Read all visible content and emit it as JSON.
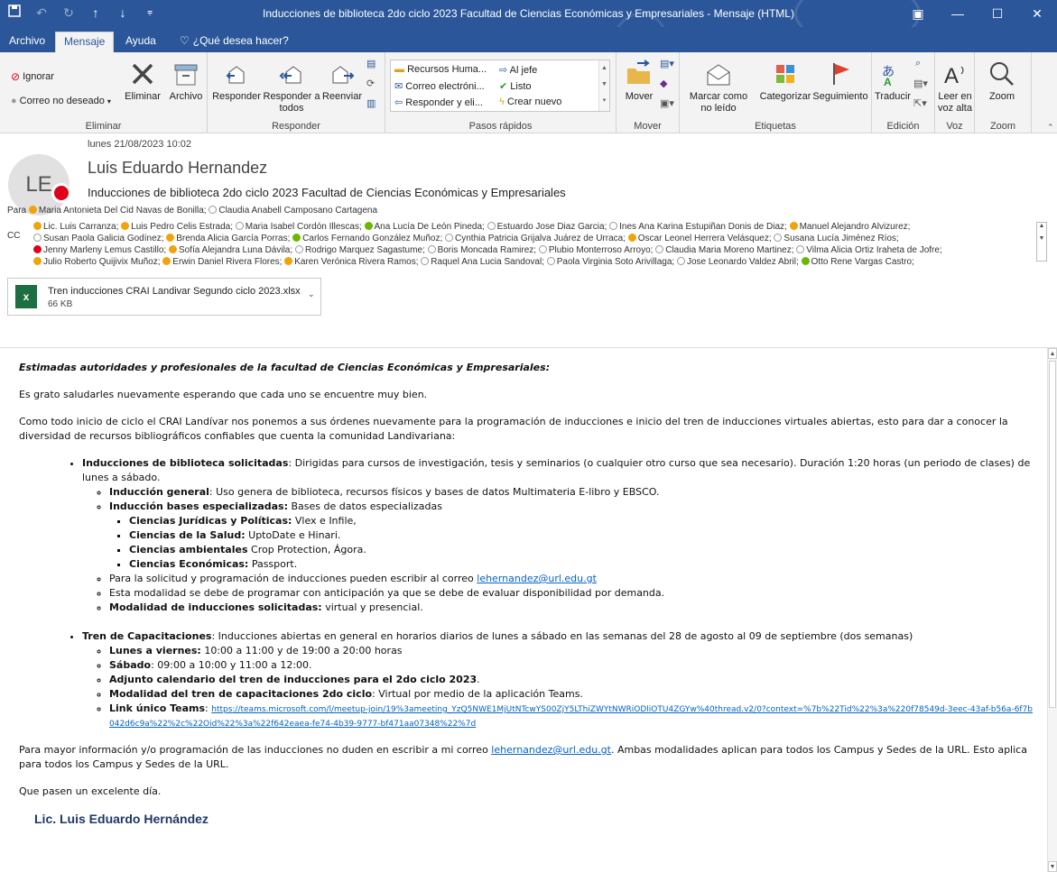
{
  "window": {
    "title": "Inducciones de biblioteca 2do ciclo 2023 Facultad de Ciencias Económicas y Empresariales - Mensaje (HTML)"
  },
  "tabs": [
    {
      "label": "Archivo"
    },
    {
      "label": "Mensaje"
    },
    {
      "label": "Ayuda"
    },
    {
      "label": "¿Qué desea hacer?"
    }
  ],
  "ribbon": {
    "eliminar": {
      "label": "Eliminar",
      "ignorar": "Ignorar",
      "junk": "Correo no deseado",
      "eliminar_btn": "Eliminar",
      "archivo": "Archivo"
    },
    "responder": {
      "label": "Responder",
      "responder": "Responder",
      "responder_todos": "Responder a todos",
      "reenviar": "Reenviar"
    },
    "pasos": {
      "label": "Pasos rápidos",
      "items": [
        "Recursos Huma...",
        "Al jefe",
        "Correo electróni...",
        "Listo",
        "Responder y eli...",
        "Crear nuevo"
      ]
    },
    "mover": {
      "label": "Mover",
      "mover": "Mover"
    },
    "etiquetas": {
      "label": "Etiquetas",
      "marcar": "Marcar como no leído",
      "categorizar": "Categorizar",
      "seguimiento": "Seguimiento"
    },
    "edicion": {
      "label": "Edición",
      "traducir": "Traducir"
    },
    "voz": {
      "label": "Voz",
      "leer": "Leer en voz alta"
    },
    "zoom": {
      "label": "Zoom",
      "zoom": "Zoom"
    }
  },
  "header": {
    "initials": "LE",
    "date": "lunes 21/08/2023 10:02",
    "sender": "Luis Eduardo Hernandez",
    "subject": "Inducciones de biblioteca 2do ciclo 2023 Facultad de Ciencias Económicas y Empresariales",
    "to_label": "Para",
    "to": [
      {
        "name": "Maria Antonieta Del Cid Navas de Bonilla",
        "status": "y"
      },
      {
        "name": "Claudia Anabell Camposano Cartagena",
        "status": "o"
      }
    ],
    "cc_label": "CC",
    "cc_lines": [
      [
        {
          "name": "Lic. Luis  Carranza",
          "status": "y"
        },
        {
          "name": "Luis Pedro Celis Estrada",
          "status": "y"
        },
        {
          "name": "Maria Isabel Cordón Illescas",
          "status": "o"
        },
        {
          "name": "Ana Lucía De León Pineda",
          "status": "g"
        },
        {
          "name": "Estuardo Jose Diaz Garcia",
          "status": "o"
        },
        {
          "name": "Ines Ana Karina Estupiñan Donis de Diaz",
          "status": "o"
        },
        {
          "name": "Manuel Alejandro Alvizurez",
          "status": "y"
        }
      ],
      [
        {
          "name": "Susan Paola Galicia Godínez",
          "status": "o"
        },
        {
          "name": "Brenda Alicia García Porras",
          "status": "y"
        },
        {
          "name": "Carlos Fernando González Muñoz",
          "status": "g"
        },
        {
          "name": "Cynthia Patricia Grijalva Juárez de Urraca",
          "status": "o"
        },
        {
          "name": "Oscar Leonel Herrera Velásquez",
          "status": "y"
        },
        {
          "name": "Susana Lucía Jiménez Ríos",
          "status": "o"
        }
      ],
      [
        {
          "name": "Jenny Marleny Lemus Castillo",
          "status": "r"
        },
        {
          "name": "Sofía Alejandra Luna Dávila",
          "status": "y"
        },
        {
          "name": "Rodrigo Marquez Sagastume",
          "status": "o"
        },
        {
          "name": "Boris Moncada Ramirez",
          "status": "o"
        },
        {
          "name": "Plubio Monterroso Arroyo",
          "status": "o"
        },
        {
          "name": "Claudia Maria Moreno Martinez",
          "status": "o"
        },
        {
          "name": "Vilma Alicia Ortiz Iraheta de Jofre",
          "status": "o"
        }
      ],
      [
        {
          "name": "Julio Roberto Quijivix Muñoz",
          "status": "y"
        },
        {
          "name": "Erwin Daniel Rivera Flores",
          "status": "y"
        },
        {
          "name": "Karen Verónica Rivera Ramos",
          "status": "y"
        },
        {
          "name": "Raquel Ana Lucia Sandoval",
          "status": "o"
        },
        {
          "name": "Paola Virginia Soto Arivillaga",
          "status": "o"
        },
        {
          "name": "Jose Leonardo Valdez Abril",
          "status": "o"
        },
        {
          "name": "Otto Rene Vargas Castro",
          "status": "g"
        }
      ]
    ],
    "status_colors": {
      "y": "#f0a30a",
      "g": "#6bb700",
      "r": "#e0001b"
    }
  },
  "attachment": {
    "name": "Tren inducciones CRAI Landivar Segundo ciclo 2023.xlsx",
    "size": "66 KB",
    "icon_letter": "x"
  },
  "body": {
    "greeting": "Estimadas autoridades y profesionales de la facultad de Ciencias Económicas y Empresariales:",
    "p1": "Es grato saludarles nuevamente esperando que cada uno se encuentre muy bien.",
    "p2": "Como todo inicio de ciclo el CRAI Landívar nos ponemos a sus órdenes nuevamente para la programación de inducciones e inicio del tren de inducciones virtuales abiertas, esto para dar a conocer la diversidad de recursos bibliográficos confiables que cuenta la comunidad Landivariana:",
    "b1_bold": "Inducciones de biblioteca solicitadas",
    "b1_text": ": Dirigidas para cursos de investigación, tesis y seminarios (o cualquier otro curso que sea necesario). Duración 1:20 horas (un periodo de clases) de lunes a sábado.",
    "b1a_bold": "Inducción general",
    "b1a_text": ": Uso genera de biblioteca, recursos físicos y bases de datos Multimateria  E-libro y EBSCO.",
    "b1b_bold": "Inducción bases especializadas:",
    "b1b_text": " Bases de datos especializadas",
    "sub": [
      {
        "bold": "Ciencias Jurídicas y Políticas:",
        "text": " Vlex e Infile,"
      },
      {
        "bold": "Ciencias de la Salud:",
        "text": " UptoDate e Hinari."
      },
      {
        "bold": "Ciencias ambientales",
        "text": " Crop Protection,  Ágora."
      },
      {
        "bold": "Ciencias Económicas:",
        "text": " Passport."
      }
    ],
    "b1c_text": "Para la solicitud y programación de inducciones pueden escribir al correo ",
    "email": "lehernandez@url.edu.gt",
    "b1d_text": "Esta modalidad se debe de programar con anticipación ya que se debe de evaluar disponibilidad por demanda.",
    "b1e_bold": "Modalidad de inducciones solicitadas:",
    "b1e_text": " virtual y presencial.",
    "b2_bold": "Tren de Capacitaciones",
    "b2_text": ": Inducciones abiertas en general en horarios diarios de lunes a sábado en las semanas del 28 de agosto al 09 de septiembre (dos semanas)",
    "b2a_bold": "Lunes a viernes:",
    "b2a_text": " 10:00 a 11:00 y de 19:00 a 20:00 horas",
    "b2b_bold": "Sábado",
    "b2b_text": ": 09:00 a 10:00 y 11:00 a 12:00.",
    "b2c_bold": "Adjunto calendario del tren de inducciones para el 2do ciclo 2023",
    "b2c_text": ".",
    "b2d_bold": "Modalidad del tren de capacitaciones 2do ciclo",
    "b2d_text": ": Virtual por medio de la aplicación Teams.",
    "b2e_bold": "Link único Teams",
    "b2e_text": ": ",
    "teams_link": "https://teams.microsoft.com/l/meetup-join/19%3ameeting_YzQ5NWE1MjUtNTcwYS00ZjY5LThiZWYtNWRiODliOTU4ZGYw%40thread.v2/0?context=%7b%22Tid%22%3a%220f78549d-3eec-43af-b56a-6f7b042d6c9a%22%2c%22Oid%22%3a%22f642eaea-fe74-4b39-9777-bf471aa07348%22%7d",
    "p3a": "Para mayor información y/o programación de las inducciones no duden en escribir a mi correo ",
    "p3b": ". Ambas modalidades aplican para todos los Campus y Sedes de la URL. Esto aplica para todos los Campus y Sedes de la URL.",
    "p4": "Que pasen un excelente día.",
    "signature": "Lic. Luis Eduardo Hernández"
  }
}
